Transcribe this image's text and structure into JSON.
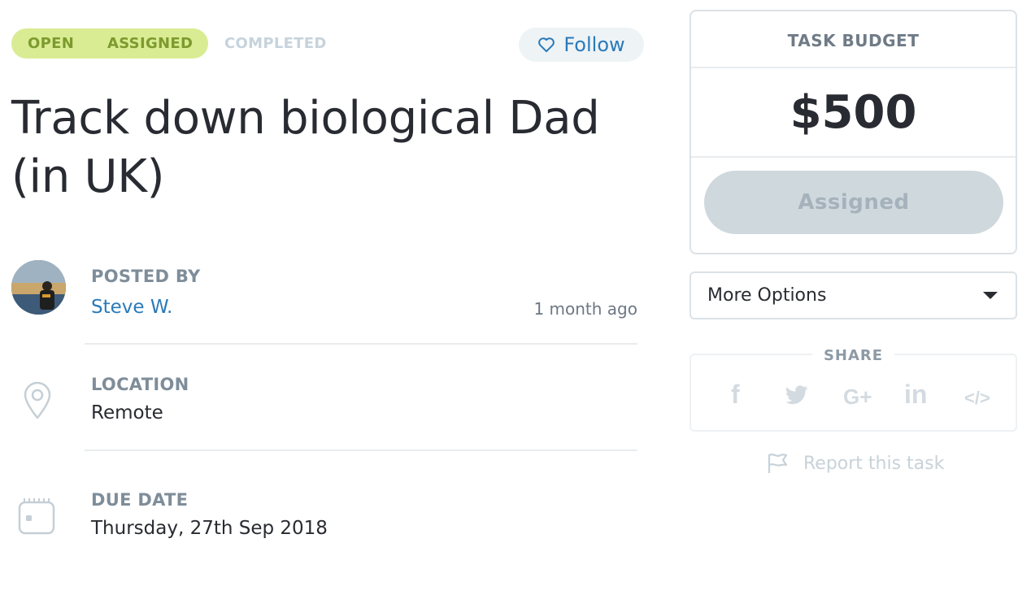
{
  "status": {
    "steps": [
      "OPEN",
      "ASSIGNED",
      "COMPLETED"
    ],
    "active_fill_color": "#d9ec93"
  },
  "follow": {
    "label": "Follow",
    "icon": "heart-outline-icon"
  },
  "task": {
    "title_line1": "Track down biological Dad",
    "title_line2": "(in UK)"
  },
  "posted_by": {
    "label": "POSTED BY",
    "name": "Steve W.",
    "time": "1 month ago"
  },
  "location": {
    "label": "LOCATION",
    "value": "Remote",
    "icon": "location-pin-icon"
  },
  "due_date": {
    "label": "DUE DATE",
    "value": "Thursday, 27th Sep 2018",
    "icon": "calendar-icon"
  },
  "budget": {
    "heading": "TASK BUDGET",
    "amount": "$500",
    "button_label": "Assigned"
  },
  "more_options": {
    "label": "More Options"
  },
  "share": {
    "heading": "SHARE",
    "facebook": "f",
    "google": "G+",
    "linkedin": "in",
    "embed": "</>"
  },
  "report": {
    "label": "Report this task",
    "icon": "flag-icon"
  }
}
